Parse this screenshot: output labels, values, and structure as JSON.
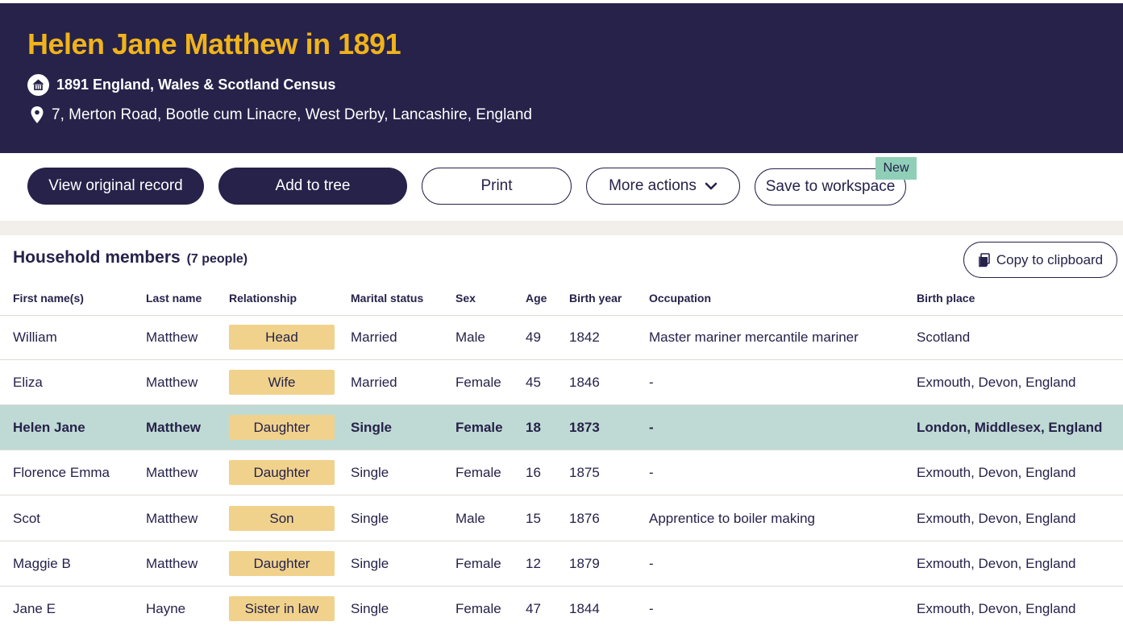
{
  "page": {
    "title": "Helen Jane Matthew in 1891",
    "census": "1891 England, Wales & Scotland Census",
    "address": "7, Merton Road, Bootle cum Linacre, West Derby, Lancashire, England"
  },
  "actions": {
    "view_original": "View original record",
    "add_to_tree": "Add to tree",
    "print": "Print",
    "more_actions": "More actions",
    "save_workspace": "Save to workspace",
    "new_badge": "New"
  },
  "household": {
    "title": "Household members",
    "count": "(7 people)",
    "copy_label": "Copy to clipboard",
    "columns": [
      "First name(s)",
      "Last name",
      "Relationship",
      "Marital status",
      "Sex",
      "Age",
      "Birth year",
      "Occupation",
      "Birth place"
    ],
    "rows": [
      {
        "first": "William",
        "last": "Matthew",
        "rel": "Head",
        "marital": "Married",
        "sex": "Male",
        "age": "49",
        "year": "1842",
        "occupation": "Master mariner mercantile mariner",
        "place": "Scotland",
        "highlight": false
      },
      {
        "first": "Eliza",
        "last": "Matthew",
        "rel": "Wife",
        "marital": "Married",
        "sex": "Female",
        "age": "45",
        "year": "1846",
        "occupation": "-",
        "place": "Exmouth, Devon, England",
        "highlight": false
      },
      {
        "first": "Helen Jane",
        "last": "Matthew",
        "rel": "Daughter",
        "marital": "Single",
        "sex": "Female",
        "age": "18",
        "year": "1873",
        "occupation": "-",
        "place": "London, Middlesex, England",
        "highlight": true
      },
      {
        "first": "Florence Emma",
        "last": "Matthew",
        "rel": "Daughter",
        "marital": "Single",
        "sex": "Female",
        "age": "16",
        "year": "1875",
        "occupation": "-",
        "place": "Exmouth, Devon, England",
        "highlight": false
      },
      {
        "first": "Scot",
        "last": "Matthew",
        "rel": "Son",
        "marital": "Single",
        "sex": "Male",
        "age": "15",
        "year": "1876",
        "occupation": "Apprentice to boiler making",
        "place": "Exmouth, Devon, England",
        "highlight": false
      },
      {
        "first": "Maggie B",
        "last": "Matthew",
        "rel": "Daughter",
        "marital": "Single",
        "sex": "Female",
        "age": "12",
        "year": "1879",
        "occupation": "-",
        "place": "Exmouth, Devon, England",
        "highlight": false
      },
      {
        "first": "Jane E",
        "last": "Hayne",
        "rel": "Sister in law",
        "marital": "Single",
        "sex": "Female",
        "age": "47",
        "year": "1844",
        "occupation": "-",
        "place": "Exmouth, Devon, England",
        "highlight": false
      }
    ]
  },
  "colors": {
    "header_bg": "#26224a",
    "title_accent": "#f0b31a",
    "highlight_row": "#bfdad4",
    "relationship_badge": "#f0d28c",
    "new_badge": "#8fcfb8"
  },
  "icons": [
    "census-home-icon",
    "location-pin-icon",
    "chevron-down-icon",
    "clipboard-icon"
  ]
}
